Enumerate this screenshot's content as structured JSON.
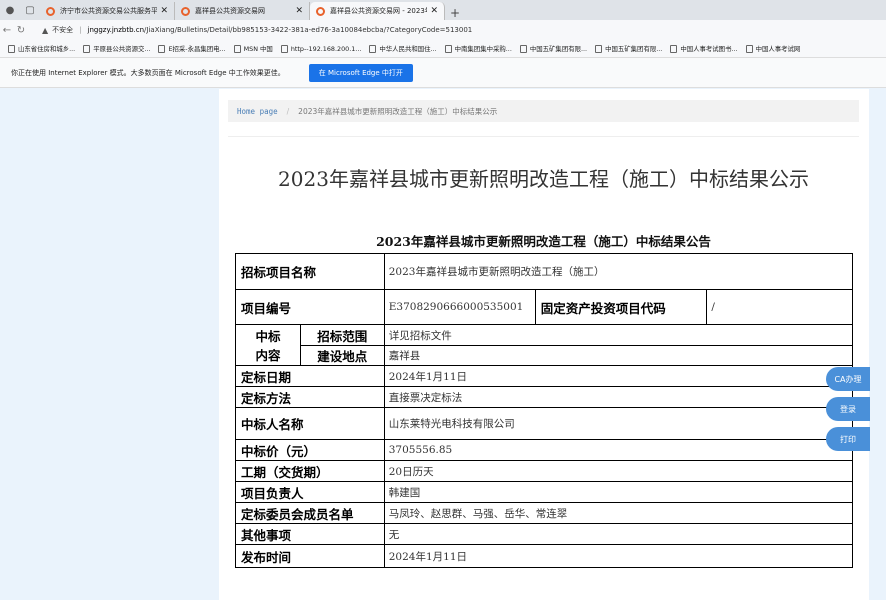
{
  "browser": {
    "tabs": [
      {
        "title": "济宁市公共资源交易公共服务平台",
        "active": false
      },
      {
        "title": "嘉祥县公共资源交易网",
        "active": false
      },
      {
        "title": "嘉祥县公共资源交易网 - 2023年嘉",
        "active": true
      }
    ],
    "insecure_label": "不安全",
    "url_host": "jnggzy.jnzbtb.cn",
    "url_path": "/JiaXiang/Bulletins/Detail/bb985153-3422-381a-ed76-3a10084ebcba/?CategoryCode=513001",
    "bookmarks": [
      "山东省住房和城乡...",
      "平原县公共资源交...",
      "E招采-永昌集团电...",
      "MSN 中国",
      "http--192.168.200.1...",
      "中华人民共和国住...",
      "中南集团集中采购...",
      "中国五矿集团有限...",
      "中国五矿集团有限...",
      "中国人事考试图书...",
      "中国人事考试网"
    ],
    "ie_message": "你正在使用 Internet Explorer 模式。大多数页面在 Microsoft Edge 中工作效果更佳。",
    "ie_button": "在 Microsoft Edge 中打开"
  },
  "breadcrumb": {
    "home": "Home page",
    "current": "2023年嘉祥县城市更新照明改造工程（施工）中标结果公示"
  },
  "page_title": "2023年嘉祥县城市更新照明改造工程（施工）中标结果公示",
  "announcement_title": "2023年嘉祥县城市更新照明改造工程（施工）中标结果公告",
  "table": {
    "project_name_label": "招标项目名称",
    "project_name": "2023年嘉祥县城市更新照明改造工程（施工）",
    "project_no_label": "项目编号",
    "project_no": "E3708290666000535001",
    "asset_code_label": "固定资产投资项目代码",
    "asset_code": "/",
    "win_content_label_1": "中标",
    "win_content_label_2": "内容",
    "scope_label": "招标范围",
    "scope": "详见招标文件",
    "location_label": "建设地点",
    "location": "嘉祥县",
    "date_label": "定标日期",
    "date": "2024年1月11日",
    "method_label": "定标方法",
    "method": "直接票决定标法",
    "winner_label": "中标人名称",
    "winner": "山东莱特光电科技有限公司",
    "price_label": "中标价（元）",
    "price": "3705556.85",
    "period_label": "工期（交货期）",
    "period": "20日历天",
    "manager_label": "项目负责人",
    "manager": "韩建国",
    "committee_label": "定标委员会成员名单",
    "committee": "马凤玲、赵思群、马强、岳华、常连翠",
    "other_label": "其他事项",
    "other": "无",
    "publish_label": "发布时间",
    "publish": "2024年1月11日"
  },
  "side_buttons": {
    "ca": "CA办理",
    "login": "登录",
    "print": "打印"
  }
}
